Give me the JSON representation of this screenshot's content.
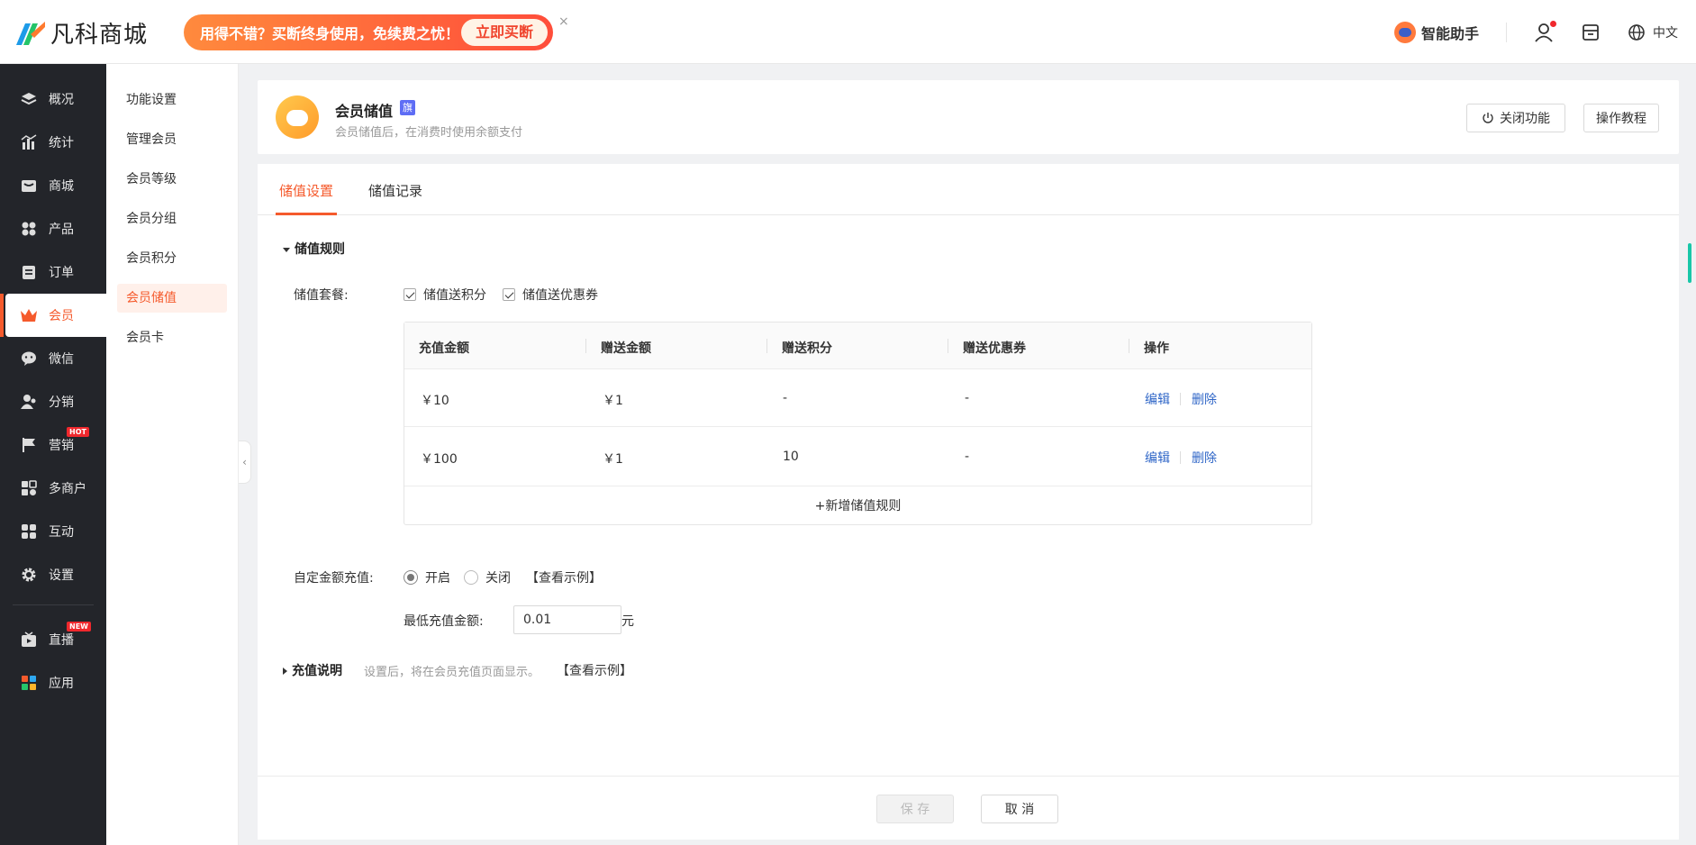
{
  "brand": {
    "name": "凡科商城"
  },
  "promo": {
    "text": "用得不错？买断终身使用，免续费之忧！",
    "button": "立即买断",
    "close": "×"
  },
  "topbar": {
    "assistant": "智能助手",
    "language": "中文"
  },
  "sidebar": {
    "items": [
      {
        "label": "概况",
        "icon": "layers-icon"
      },
      {
        "label": "统计",
        "icon": "chart-icon"
      },
      {
        "label": "商城",
        "icon": "store-icon"
      },
      {
        "label": "产品",
        "icon": "grid-icon"
      },
      {
        "label": "订单",
        "icon": "clipboard-icon"
      },
      {
        "label": "会员",
        "icon": "crown-icon",
        "active": true
      },
      {
        "label": "微信",
        "icon": "wechat-icon"
      },
      {
        "label": "分销",
        "icon": "users-icon"
      },
      {
        "label": "营销",
        "icon": "flag-icon",
        "badge": "HOT"
      },
      {
        "label": "多商户",
        "icon": "merchant-icon"
      },
      {
        "label": "互动",
        "icon": "interact-icon"
      },
      {
        "label": "设置",
        "icon": "gear-icon"
      },
      {
        "label": "直播",
        "icon": "tv-icon",
        "badge": "NEW"
      },
      {
        "label": "应用",
        "icon": "apps-icon"
      }
    ]
  },
  "subnav": {
    "items": [
      "功能设置",
      "管理会员",
      "会员等级",
      "会员分组",
      "会员积分",
      "会员储值",
      "会员卡"
    ],
    "active": "会员储值"
  },
  "header": {
    "title": "会员储值",
    "tag": "旗",
    "desc": "会员储值后，在消费时使用余额支付",
    "close_feature": "关闭功能",
    "tutorial": "操作教程"
  },
  "tabs": [
    "储值设置",
    "储值记录"
  ],
  "rules": {
    "section_title": "储值规则",
    "package_label": "储值套餐:",
    "option_points": "储值送积分",
    "option_coupon": "储值送优惠券",
    "columns": [
      "充值金额",
      "赠送金额",
      "赠送积分",
      "赠送优惠券",
      "操作"
    ],
    "rows": [
      {
        "amount": "￥10",
        "bonus": "￥1",
        "points": "-",
        "coupon": "-"
      },
      {
        "amount": "￥100",
        "bonus": "￥1",
        "points": "10",
        "coupon": "-"
      }
    ],
    "edit": "编辑",
    "delete": "删除",
    "add": "+新增储值规则"
  },
  "custom": {
    "label": "自定金额充值:",
    "on": "开启",
    "off": "关闭",
    "example": "【查看示例】",
    "min_label": "最低充值金额:",
    "min_value": "0.01",
    "unit": "元"
  },
  "instructions": {
    "title": "充值说明",
    "desc": "设置后，将在会员充值页面显示。",
    "example": "【查看示例】"
  },
  "footer": {
    "save": "保 存",
    "cancel": "取 消"
  },
  "colors": {
    "accent": "#f55a2c",
    "sidebar": "#23252a",
    "link": "#2f66c7"
  }
}
